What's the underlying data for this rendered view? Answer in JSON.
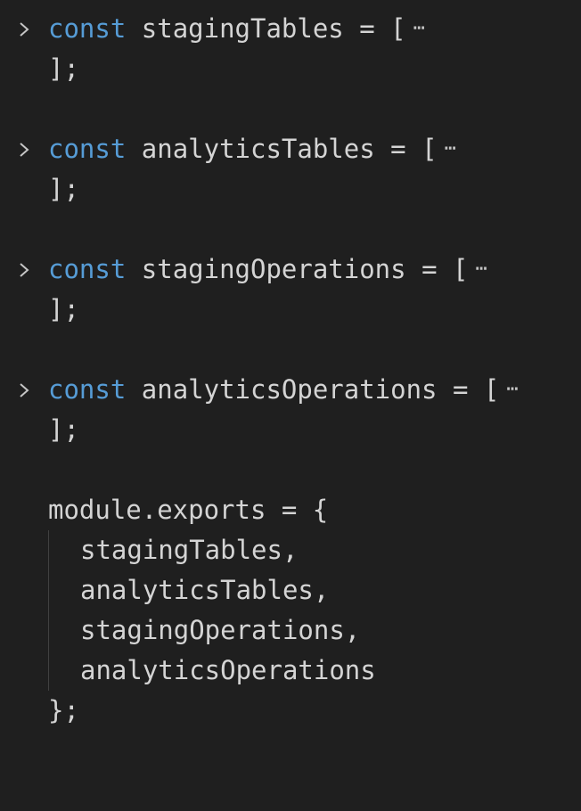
{
  "editor": {
    "blocks": [
      {
        "keyword": "const",
        "name": "stagingTables",
        "operator": "=",
        "open": "[",
        "folded": "⋯",
        "close": "];"
      },
      {
        "keyword": "const",
        "name": "analyticsTables",
        "operator": "=",
        "open": "[",
        "folded": "⋯",
        "close": "];"
      },
      {
        "keyword": "const",
        "name": "stagingOperations",
        "operator": "=",
        "open": "[",
        "folded": "⋯",
        "close": "];"
      },
      {
        "keyword": "const",
        "name": "analyticsOperations",
        "operator": "=",
        "open": "[",
        "folded": "⋯",
        "close": "];"
      }
    ],
    "exports": {
      "head": "module.exports = {",
      "items": [
        "stagingTables,",
        "analyticsTables,",
        "stagingOperations,",
        "analyticsOperations"
      ],
      "close": "};"
    },
    "icons": {
      "fold": "chevron-right-icon"
    },
    "colors": {
      "background": "#1f1f1f",
      "keyword": "#569cd6",
      "text": "#d4d4d4"
    }
  }
}
